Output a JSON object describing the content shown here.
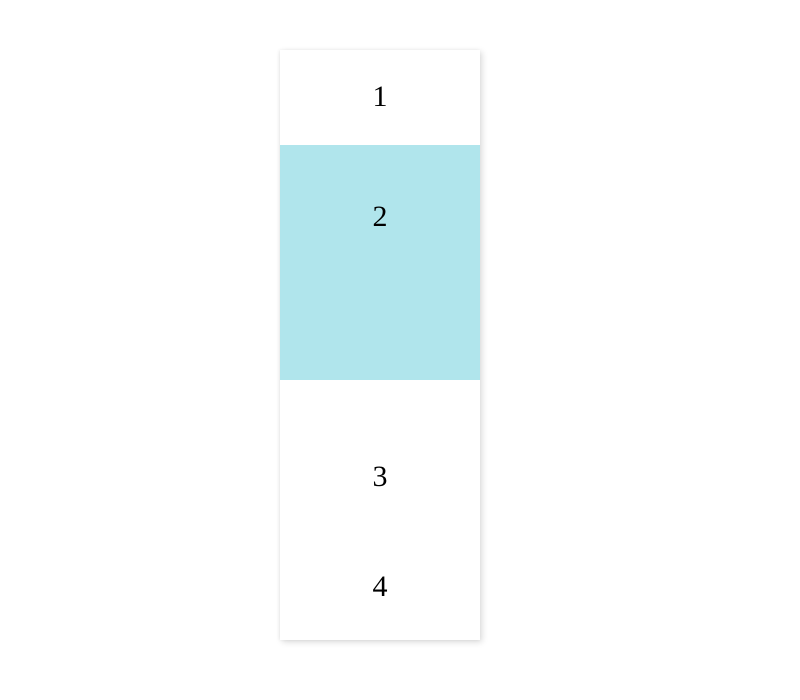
{
  "panel": {
    "cells": [
      {
        "label": "1",
        "highlighted": false
      },
      {
        "label": "2",
        "highlighted": true
      },
      {
        "label": "3",
        "highlighted": false
      },
      {
        "label": "4",
        "highlighted": false
      }
    ],
    "highlight_color": "#b0e5ec"
  }
}
